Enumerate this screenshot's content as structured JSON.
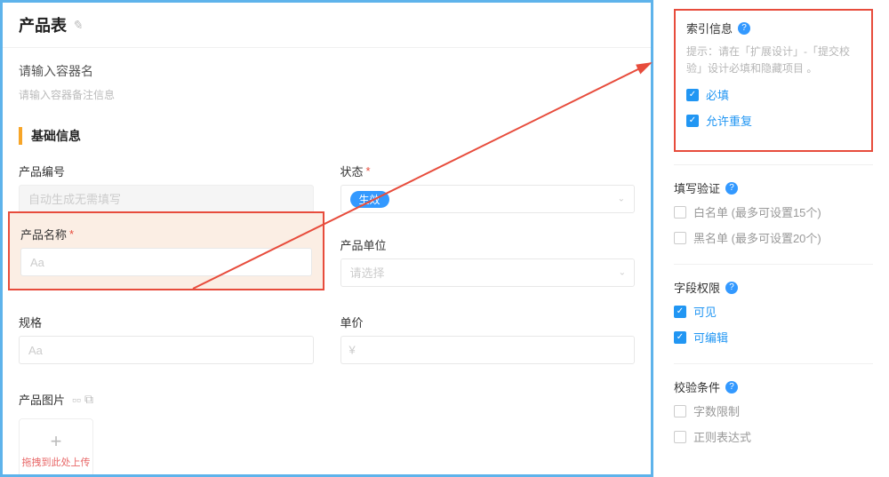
{
  "form": {
    "title": "产品表",
    "container_prompt": "请输入容器名",
    "container_sub": "请输入容器备注信息",
    "section_title": "基础信息",
    "fields": {
      "code": {
        "label": "产品编号",
        "placeholder": "自动生成无需填写"
      },
      "status": {
        "label": "状态",
        "pill": "生效"
      },
      "name": {
        "label": "产品名称",
        "placeholder": "Aa"
      },
      "unit": {
        "label": "产品单位",
        "placeholder": "请选择"
      },
      "spec": {
        "label": "规格",
        "placeholder": "Aa"
      },
      "price": {
        "label": "单价",
        "symbol": "¥"
      },
      "image": {
        "label": "产品图片",
        "hint": "拖拽到此处上传"
      }
    }
  },
  "side": {
    "index_info": {
      "title": "索引信息",
      "hint": "提示：请在「扩展设计」-「提交校验」设计必填和隐藏项目 。",
      "required": "必填",
      "allow_repeat": "允许重复"
    },
    "fill_validate": {
      "title": "填写验证",
      "whitelist": "白名单 (最多可设置15个)",
      "blacklist": "黑名单 (最多可设置20个)"
    },
    "perm": {
      "title": "字段权限",
      "visible": "可见",
      "editable": "可编辑"
    },
    "rule": {
      "title": "校验条件",
      "char_limit": "字数限制",
      "regex": "正则表达式"
    }
  }
}
